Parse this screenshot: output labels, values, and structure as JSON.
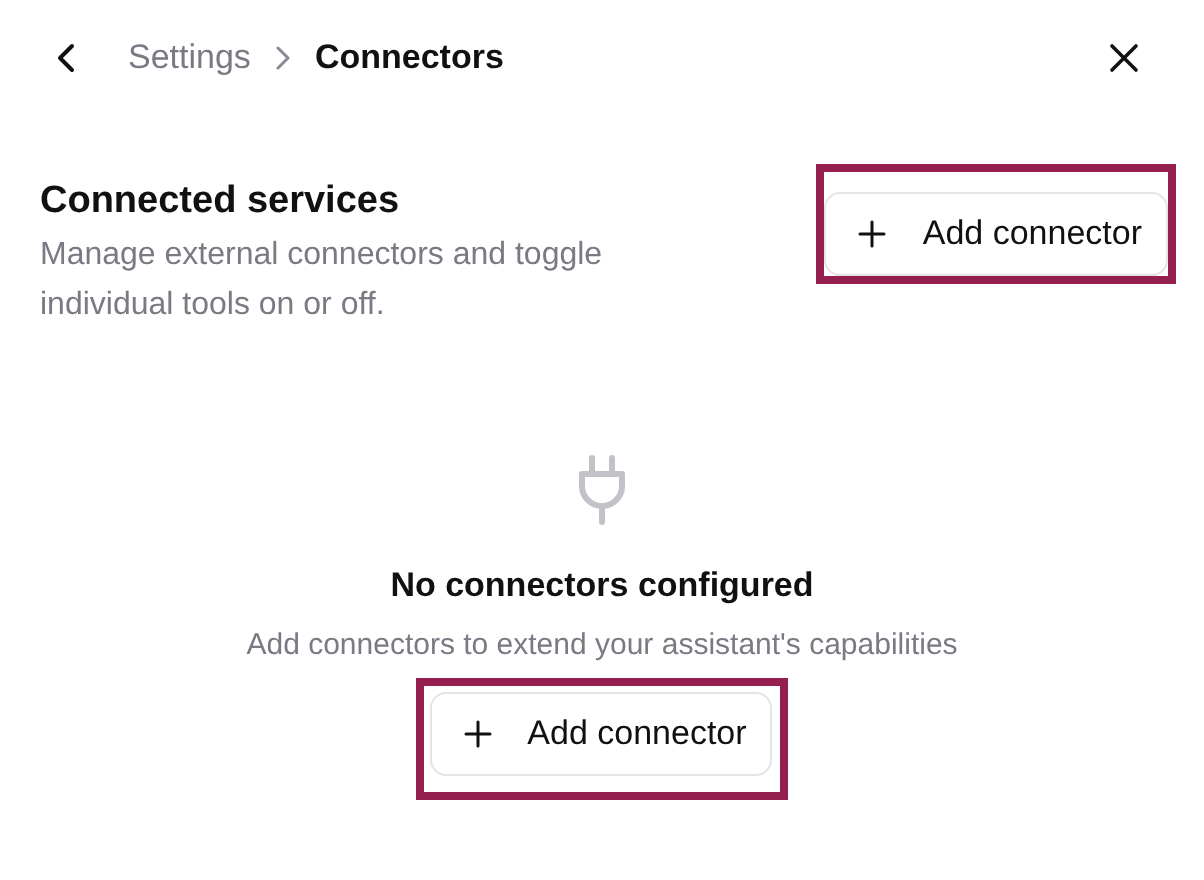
{
  "header": {
    "breadcrumb": [
      {
        "label": "Settings",
        "selected": false
      },
      {
        "label": "Connectors",
        "selected": true
      }
    ]
  },
  "section": {
    "title": "Connected services",
    "description": "Manage external connectors and toggle individual tools on or off.",
    "button": "Add connector"
  },
  "empty_state": {
    "title": "No connectors configured",
    "description": "Add connectors to extend your assistant's capabilities",
    "button": "Add connector"
  }
}
